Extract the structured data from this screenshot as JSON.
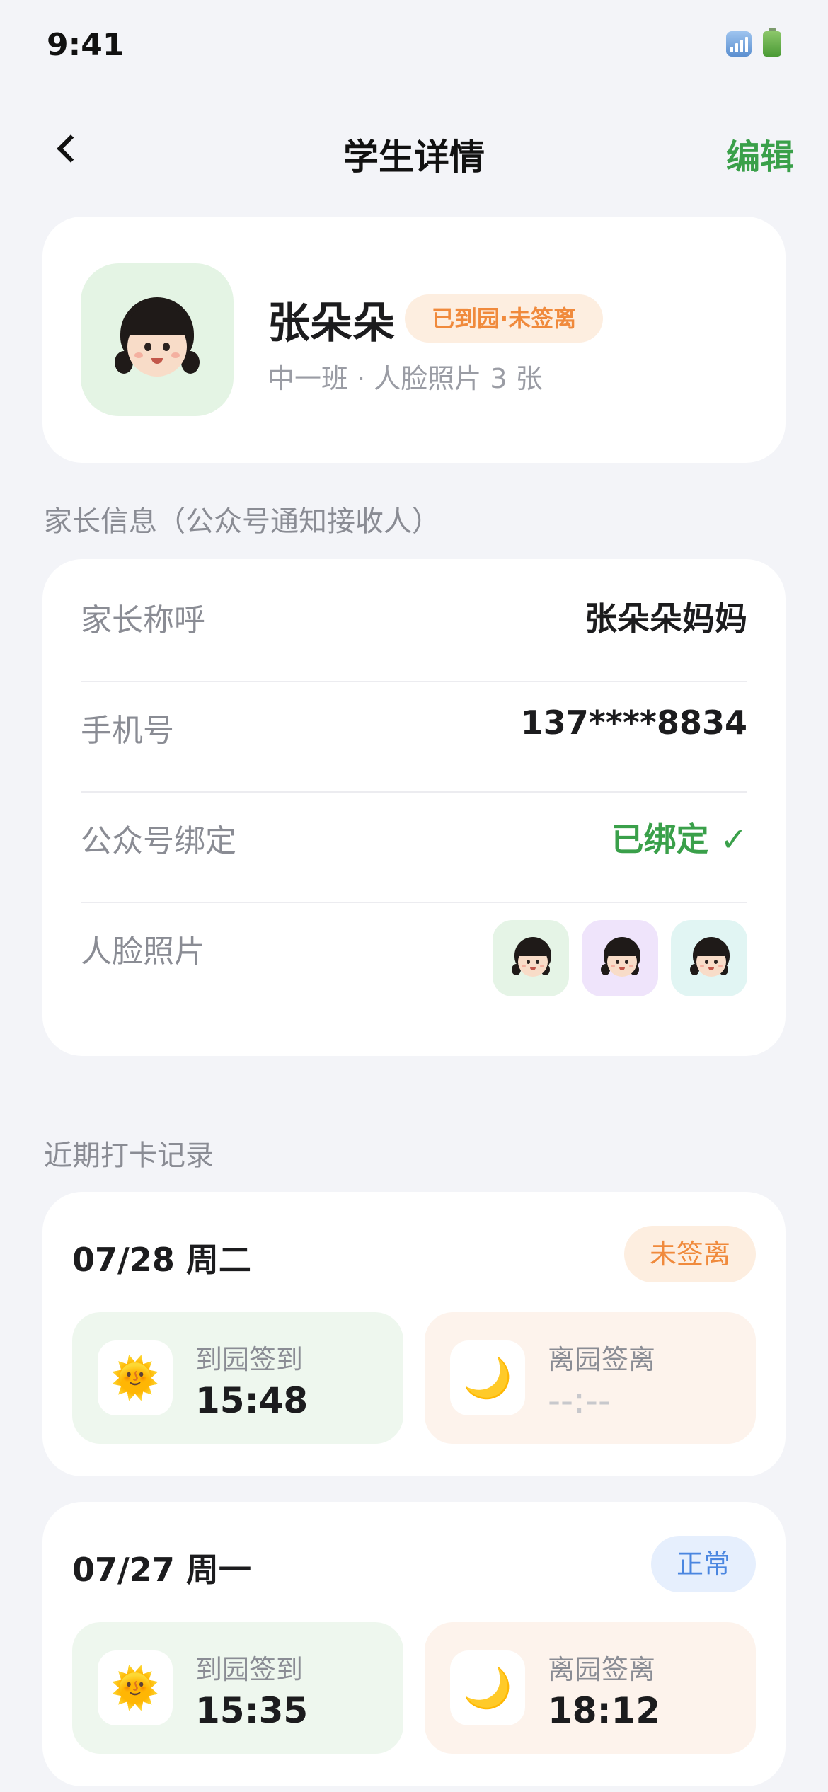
{
  "status_bar": {
    "time": "9:41"
  },
  "nav": {
    "title": "学生详情",
    "edit_label": "编辑"
  },
  "profile": {
    "name": "张朵朵",
    "badge": "已到园·未签离",
    "subtitle": "中一班 · 人脸照片 3 张"
  },
  "parent_section": {
    "title": "家长信息（公众号通知接收人）",
    "rows": [
      {
        "label": "家长称呼",
        "value": "张朵朵妈妈"
      },
      {
        "label": "手机号",
        "value": "137****8834"
      },
      {
        "label": "公众号绑定",
        "value": "已绑定 ✓"
      },
      {
        "label": "人脸照片"
      }
    ]
  },
  "records_section": {
    "title": "近期打卡记录",
    "records": [
      {
        "date": "07/28 周二",
        "status": "未签离",
        "checkin_label": "到园签到",
        "checkin_time": "15:48",
        "checkout_label": "离园签离",
        "checkout_time": "--:--"
      },
      {
        "date": "07/27 周一",
        "status": "正常",
        "checkin_label": "到园签到",
        "checkin_time": "15:35",
        "checkout_label": "离园签离",
        "checkout_time": "18:12"
      }
    ]
  },
  "icons": {
    "checkin": "🌞",
    "checkout": "🌙"
  },
  "colors": {
    "accent_green": "#3aa04a",
    "warning_orange": "#f08a3c",
    "info_blue": "#4a86e0"
  }
}
